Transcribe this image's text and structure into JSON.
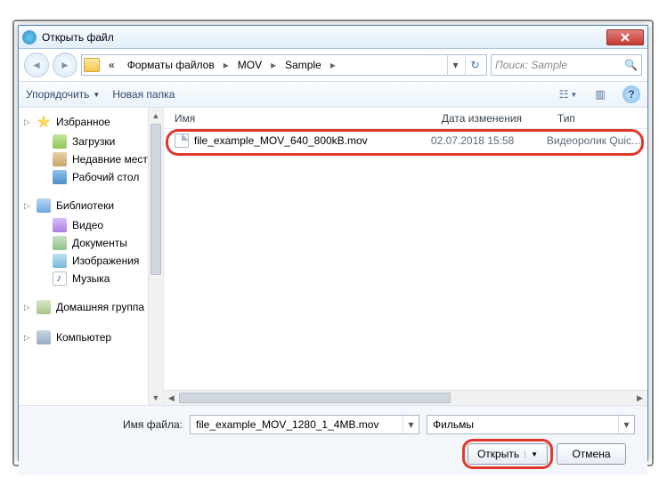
{
  "title": "Открыть файл",
  "breadcrumb": {
    "prefix": "«",
    "items": [
      "Форматы файлов",
      "MOV",
      "Sample"
    ]
  },
  "search": {
    "placeholder": "Поиск: Sample"
  },
  "toolbar": {
    "organize": "Упорядочить",
    "new_folder": "Новая папка"
  },
  "sidebar": {
    "groups": [
      {
        "head": "Избранное",
        "icon": "star",
        "items": [
          {
            "label": "Загрузки",
            "icon": "dl"
          },
          {
            "label": "Недавние места",
            "icon": "recent"
          },
          {
            "label": "Рабочий стол",
            "icon": "desktop"
          }
        ]
      },
      {
        "head": "Библиотеки",
        "icon": "lib",
        "items": [
          {
            "label": "Видео",
            "icon": "video"
          },
          {
            "label": "Документы",
            "icon": "doc"
          },
          {
            "label": "Изображения",
            "icon": "img"
          },
          {
            "label": "Музыка",
            "icon": "music"
          }
        ]
      },
      {
        "head": "Домашняя группа",
        "icon": "home",
        "items": []
      },
      {
        "head": "Компьютер",
        "icon": "comp",
        "items": []
      }
    ]
  },
  "columns": {
    "name": "Имя",
    "date": "Дата изменения",
    "type": "Тип"
  },
  "files": [
    {
      "name": "file_example_MOV_640_800kB.mov",
      "date": "02.07.2018 15:58",
      "type": "Видеоролик Quic..."
    }
  ],
  "filename_label": "Имя файла:",
  "filename_value": "file_example_MOV_1280_1_4MB.mov",
  "filter_value": "Фильмы",
  "buttons": {
    "open": "Открыть",
    "cancel": "Отмена"
  }
}
